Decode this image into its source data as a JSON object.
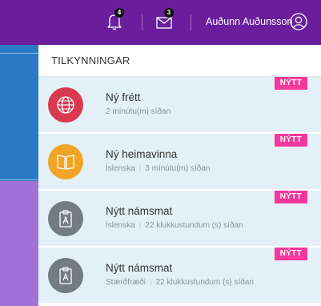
{
  "header": {
    "notification_count": "4",
    "message_count": "3",
    "user_name": "Auðunn Auðunsson"
  },
  "panel": {
    "title": "TILKYNNINGAR",
    "items": [
      {
        "title": "Ný frétt",
        "subject": "",
        "time": "2 mínútu(m) síðan",
        "badge": "NÝTT",
        "icon": "globe-icon",
        "color": "#d93a52"
      },
      {
        "title": "Ný heimavinna",
        "subject": "Íslenska",
        "time": "3 mínútu(m) síðan",
        "badge": "NÝTT",
        "icon": "book-icon",
        "color": "#f0a526"
      },
      {
        "title": "Nýtt námsmat",
        "subject": "Íslenska",
        "time": "22 klukkustundum (s) síðan",
        "badge": "NÝTT",
        "icon": "clipboard-icon",
        "color": "#737b83"
      },
      {
        "title": "Nýtt námsmat",
        "subject": "Stærðfræði",
        "time": "22 klukkustundum (s) síðan",
        "badge": "NÝTT",
        "icon": "clipboard-icon",
        "color": "#737b83"
      }
    ]
  },
  "colors": {
    "topbar": "#6a1e9c",
    "badge": "#f5389b",
    "item_background": "#e4f0f8"
  }
}
